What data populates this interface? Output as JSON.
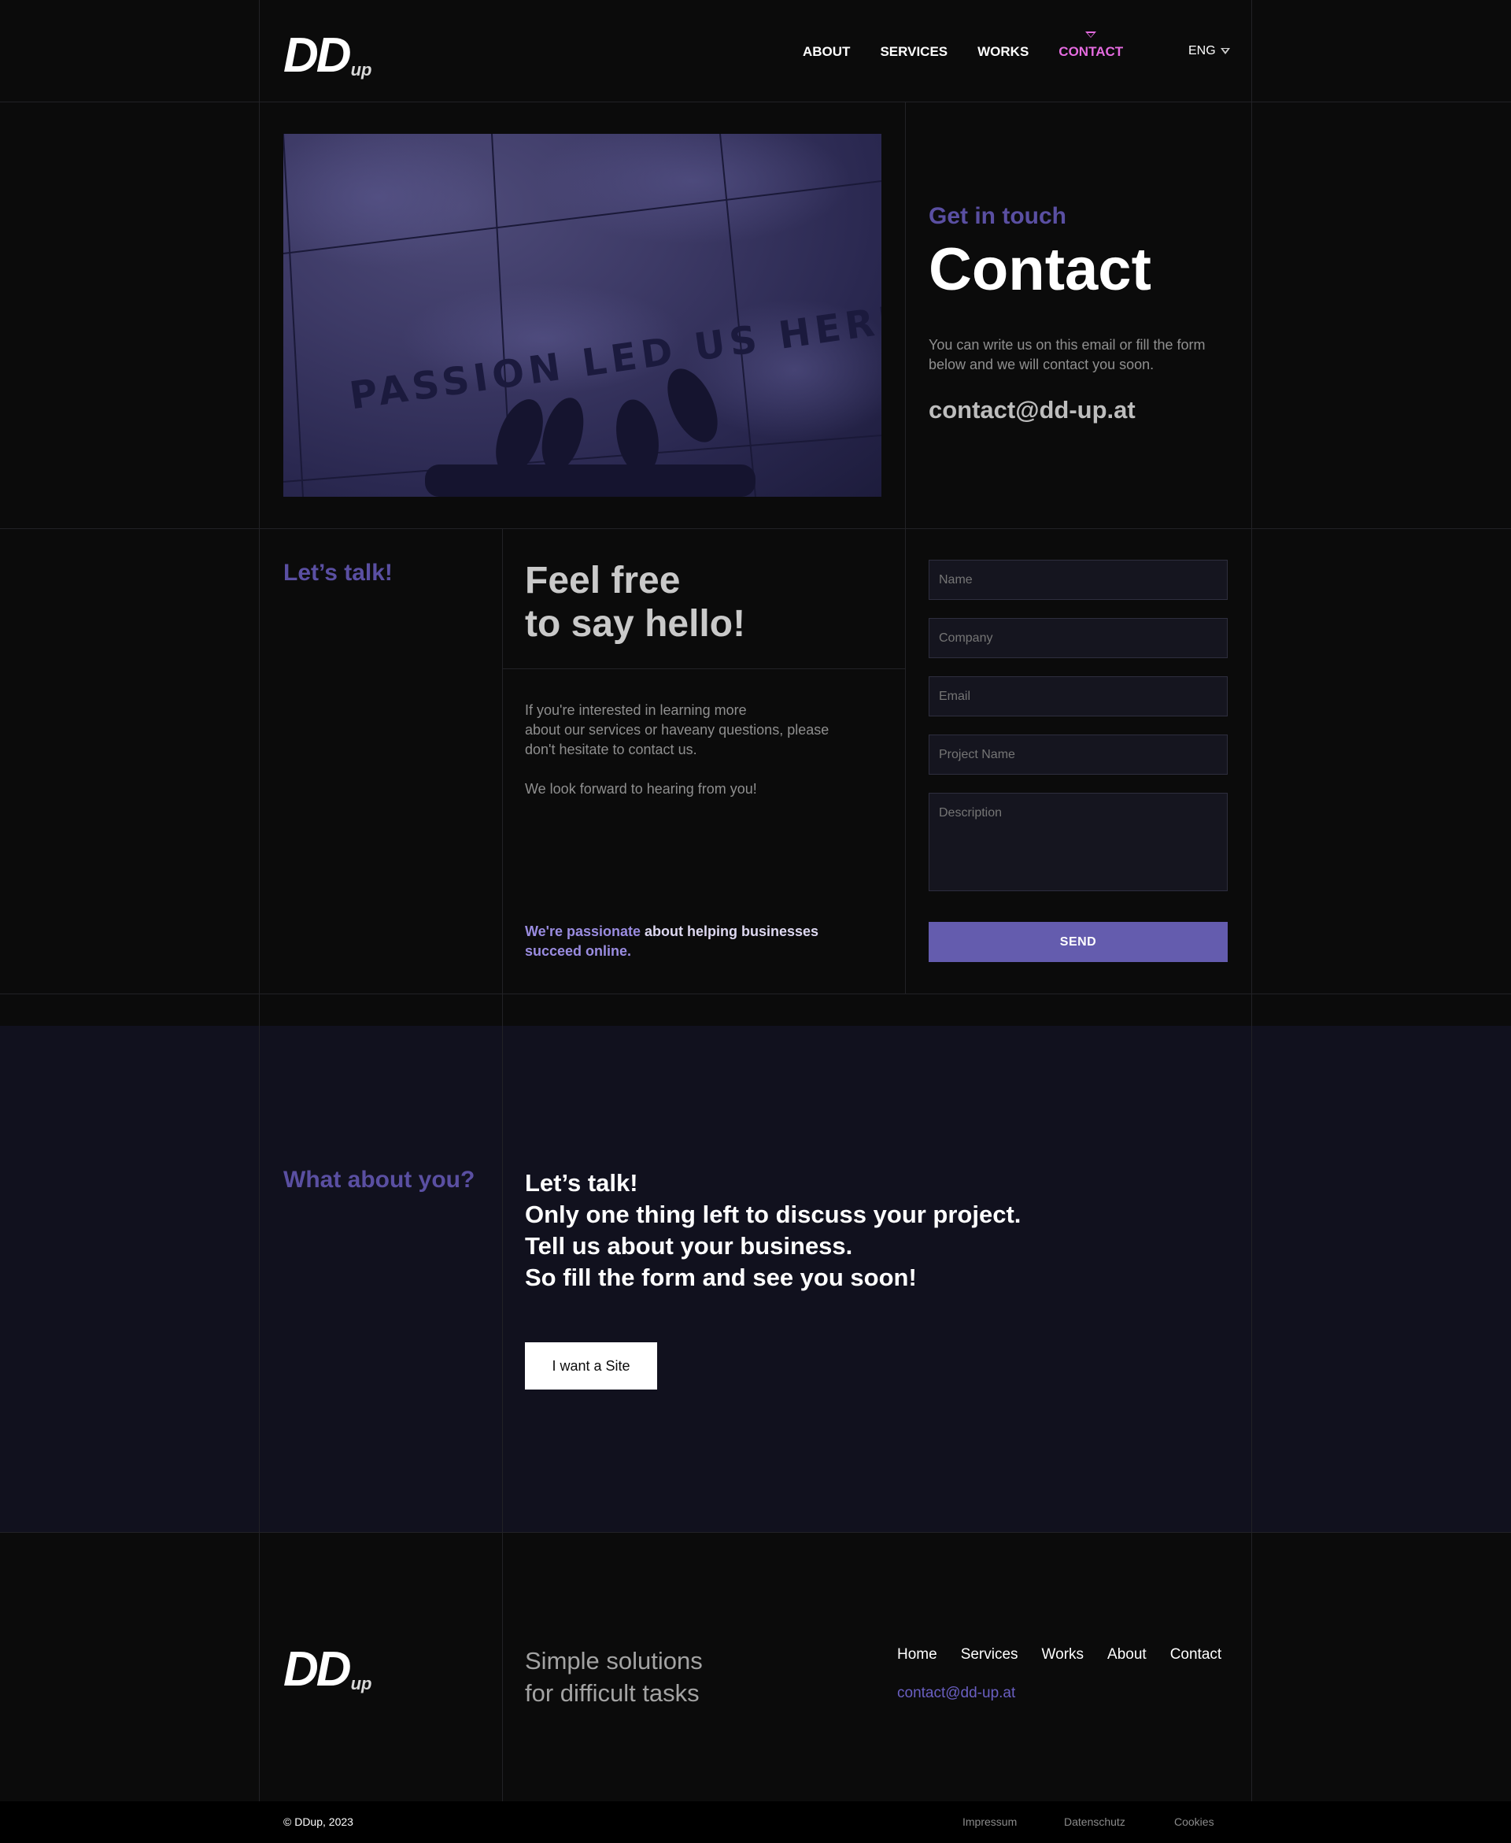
{
  "brand": {
    "logo_main": "DD",
    "logo_sub": "up"
  },
  "nav": {
    "items": [
      {
        "label": "ABOUT",
        "active": false
      },
      {
        "label": "SERVICES",
        "active": false
      },
      {
        "label": "WORKS",
        "active": false
      },
      {
        "label": "CONTACT",
        "active": true
      }
    ],
    "language": "ENG"
  },
  "hero": {
    "image_text": "PASSION LED US HERE",
    "eyebrow": "Get in touch",
    "title": "Contact",
    "description": "You can write us on this email or fill the form below and we will contact you soon.",
    "email": "contact@dd-up.at"
  },
  "talk": {
    "eyebrow": "Let’s talk!",
    "headline_line1": "Feel free",
    "headline_line2": "to say hello!",
    "para1_line1": "If you're interested in learning more",
    "para1_line2": "about our services or haveany questions, please",
    "para1_line3": "don't hesitate to contact us.",
    "para2": "We look forward to hearing from you!",
    "passion_part1": "We're passionate",
    "passion_part2": " about helping businesses",
    "passion_part3": "succeed online."
  },
  "form": {
    "name_placeholder": "Name",
    "company_placeholder": "Company",
    "email_placeholder": "Email",
    "project_placeholder": "Project Name",
    "description_placeholder": "Description",
    "send_label": "SEND"
  },
  "about_you": {
    "eyebrow": "What about you?",
    "line1": "Let’s talk!",
    "line2": "Only one thing left to discuss your project.",
    "line3": "Tell us about your business.",
    "line4": "So fill the form and see you soon!",
    "cta_label": "I want a Site"
  },
  "footer": {
    "tagline_line1": "Simple solutions",
    "tagline_line2": "for difficult tasks",
    "links": [
      "Home",
      "Services",
      "Works",
      "About",
      "Contact"
    ],
    "email": "contact@dd-up.at",
    "copyright": "© DDup, 2023",
    "legal": [
      "Impressum",
      "Datenschutz",
      "Cookies"
    ]
  },
  "colors": {
    "background": "#0b0b0b",
    "accent": "#645cae",
    "active_nav": "#e56be0",
    "eyebrow": "#5a4fa2",
    "band": "#11111e"
  }
}
